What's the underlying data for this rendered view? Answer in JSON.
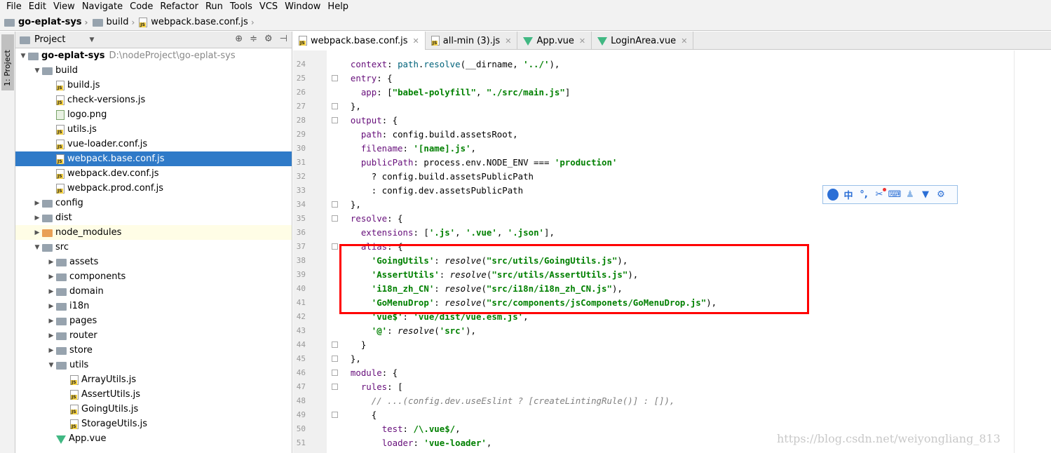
{
  "menu": [
    "File",
    "Edit",
    "View",
    "Navigate",
    "Code",
    "Refactor",
    "Run",
    "Tools",
    "VCS",
    "Window",
    "Help"
  ],
  "breadcrumb": {
    "project": "go-eplat-sys",
    "folder": "build",
    "file": "webpack.base.conf.js"
  },
  "toolstrip": {
    "project_tab": "1: Project"
  },
  "panel": {
    "title": "Project"
  },
  "tree": [
    {
      "depth": 0,
      "arrow": "open",
      "icon": "folder",
      "label": "go-eplat-sys",
      "path": "D:\\nodeProject\\go-eplat-sys",
      "bold": true
    },
    {
      "depth": 1,
      "arrow": "open",
      "icon": "folder",
      "label": "build"
    },
    {
      "depth": 2,
      "arrow": "",
      "icon": "js",
      "label": "build.js"
    },
    {
      "depth": 2,
      "arrow": "",
      "icon": "js",
      "label": "check-versions.js"
    },
    {
      "depth": 2,
      "arrow": "",
      "icon": "png",
      "label": "logo.png"
    },
    {
      "depth": 2,
      "arrow": "",
      "icon": "js",
      "label": "utils.js"
    },
    {
      "depth": 2,
      "arrow": "",
      "icon": "js",
      "label": "vue-loader.conf.js"
    },
    {
      "depth": 2,
      "arrow": "",
      "icon": "js",
      "label": "webpack.base.conf.js",
      "selected": true
    },
    {
      "depth": 2,
      "arrow": "",
      "icon": "js",
      "label": "webpack.dev.conf.js"
    },
    {
      "depth": 2,
      "arrow": "",
      "icon": "js",
      "label": "webpack.prod.conf.js"
    },
    {
      "depth": 1,
      "arrow": "closed",
      "icon": "folder",
      "label": "config"
    },
    {
      "depth": 1,
      "arrow": "closed",
      "icon": "folder",
      "label": "dist"
    },
    {
      "depth": 1,
      "arrow": "closed",
      "icon": "folder-orange",
      "label": "node_modules",
      "hover": true
    },
    {
      "depth": 1,
      "arrow": "open",
      "icon": "folder",
      "label": "src"
    },
    {
      "depth": 2,
      "arrow": "closed",
      "icon": "folder",
      "label": "assets"
    },
    {
      "depth": 2,
      "arrow": "closed",
      "icon": "folder",
      "label": "components"
    },
    {
      "depth": 2,
      "arrow": "closed",
      "icon": "folder",
      "label": "domain"
    },
    {
      "depth": 2,
      "arrow": "closed",
      "icon": "folder",
      "label": "i18n"
    },
    {
      "depth": 2,
      "arrow": "closed",
      "icon": "folder",
      "label": "pages"
    },
    {
      "depth": 2,
      "arrow": "closed",
      "icon": "folder",
      "label": "router"
    },
    {
      "depth": 2,
      "arrow": "closed",
      "icon": "folder",
      "label": "store"
    },
    {
      "depth": 2,
      "arrow": "open",
      "icon": "folder",
      "label": "utils"
    },
    {
      "depth": 3,
      "arrow": "",
      "icon": "js",
      "label": "ArrayUtils.js"
    },
    {
      "depth": 3,
      "arrow": "",
      "icon": "js",
      "label": "AssertUtils.js"
    },
    {
      "depth": 3,
      "arrow": "",
      "icon": "js",
      "label": "GoingUtils.js"
    },
    {
      "depth": 3,
      "arrow": "",
      "icon": "js",
      "label": "StorageUtils.js"
    },
    {
      "depth": 2,
      "arrow": "",
      "icon": "vue",
      "label": "App.vue"
    }
  ],
  "tabs": [
    {
      "label": "webpack.base.conf.js",
      "icon": "js",
      "active": true
    },
    {
      "label": "all-min (3).js",
      "icon": "js"
    },
    {
      "label": "App.vue",
      "icon": "vue"
    },
    {
      "label": "LoginArea.vue",
      "icon": "vue"
    }
  ],
  "code": [
    {
      "n": "24",
      "fold": false,
      "html": "  <span class=\"p\">context</span>: <span class=\"m\">path</span>.<span class=\"m\">resolve</span>(__dirname, <span class=\"s\">'../'</span>),"
    },
    {
      "n": "25",
      "fold": true,
      "html": "  <span class=\"p\">entry</span>: {"
    },
    {
      "n": "26",
      "fold": false,
      "html": "    <span class=\"p\">app</span>: [<span class=\"s\">\"babel-polyfill\"</span>, <span class=\"s\">\"./src/main.js\"</span>]"
    },
    {
      "n": "27",
      "fold": true,
      "html": "  },"
    },
    {
      "n": "28",
      "fold": true,
      "html": "  <span class=\"p\">output</span>: {"
    },
    {
      "n": "29",
      "fold": false,
      "html": "    <span class=\"p\">path</span>: config.build.assetsRoot,"
    },
    {
      "n": "30",
      "fold": false,
      "html": "    <span class=\"p\">filename</span>: <span class=\"s\">'[name].js'</span>,"
    },
    {
      "n": "31",
      "fold": false,
      "html": "    <span class=\"p\">publicPath</span>: process.env.NODE_ENV === <span class=\"s\">'production'</span>"
    },
    {
      "n": "32",
      "fold": false,
      "html": "      ? config.build.assetsPublicPath"
    },
    {
      "n": "33",
      "fold": false,
      "html": "      : config.dev.assetsPublicPath"
    },
    {
      "n": "34",
      "fold": true,
      "html": "  },"
    },
    {
      "n": "35",
      "fold": true,
      "html": "  <span class=\"p\">resolve</span>: {"
    },
    {
      "n": "36",
      "fold": false,
      "html": "    <span class=\"p\">extensions</span>: [<span class=\"s\">'.js'</span>, <span class=\"s\">'.vue'</span>, <span class=\"s\">'.json'</span>],"
    },
    {
      "n": "37",
      "fold": true,
      "html": "    <span class=\"p\">alias</span>: {"
    },
    {
      "n": "38",
      "fold": false,
      "html": "      <span class=\"s\">'GoingUtils'</span>: <span class=\"f\">resolve</span>(<span class=\"s\">\"src/utils/GoingUtils.js\"</span>),"
    },
    {
      "n": "39",
      "fold": false,
      "html": "      <span class=\"s\">'AssertUtils'</span>: <span class=\"f\">resolve</span>(<span class=\"s\">\"src/utils/AssertUtils.js\"</span>),"
    },
    {
      "n": "40",
      "fold": false,
      "html": "      <span class=\"s\">'i18n_zh_CN'</span>: <span class=\"f\">resolve</span>(<span class=\"s\">\"src/i18n/i18n_zh_CN.js\"</span>),"
    },
    {
      "n": "41",
      "fold": false,
      "html": "      <span class=\"s\">'GoMenuDrop'</span>: <span class=\"f\">resolve</span>(<span class=\"s\">\"src/components/jsComponets/GoMenuDrop.js\"</span>),"
    },
    {
      "n": "42",
      "fold": false,
      "html": "      <span class=\"s\">'vue$'</span>: <span class=\"s\">'vue/dist/vue.esm.js'</span>,"
    },
    {
      "n": "43",
      "fold": false,
      "html": "      <span class=\"s\">'@'</span>: <span class=\"f\">resolve</span>(<span class=\"s\">'src'</span>),"
    },
    {
      "n": "44",
      "fold": true,
      "html": "    }"
    },
    {
      "n": "45",
      "fold": true,
      "html": "  },"
    },
    {
      "n": "46",
      "fold": true,
      "html": "  <span class=\"p\">module</span>: {"
    },
    {
      "n": "47",
      "fold": true,
      "html": "    <span class=\"p\">rules</span>: ["
    },
    {
      "n": "48",
      "fold": false,
      "html": "      <span class=\"c\">// ...(config.dev.useEslint ? [createLintingRule()] : []),</span>"
    },
    {
      "n": "49",
      "fold": true,
      "html": "      {"
    },
    {
      "n": "50",
      "fold": false,
      "html": "        <span class=\"p\">test</span>: <span class=\"s\">/\\.vue$/</span>,"
    },
    {
      "n": "51",
      "fold": false,
      "html": "        <span class=\"p\">loader</span>: <span class=\"s\">'vue-loader'</span>,"
    }
  ],
  "ime_toolbar": {
    "icons": [
      "user-icon",
      "chinese-mode-icon",
      "punctuation-icon",
      "scissors-icon",
      "keyboard-icon",
      "person-icon",
      "skin-icon",
      "settings-icon"
    ],
    "mode_char": "中",
    "punct_char": "°,"
  },
  "watermark": "https://blog.csdn.net/weiyongliang_813",
  "colors": {
    "selection": "#2f7ac8",
    "highlight_box": "#ff0000",
    "keyword_property": "#660e7a",
    "string": "#008000"
  }
}
